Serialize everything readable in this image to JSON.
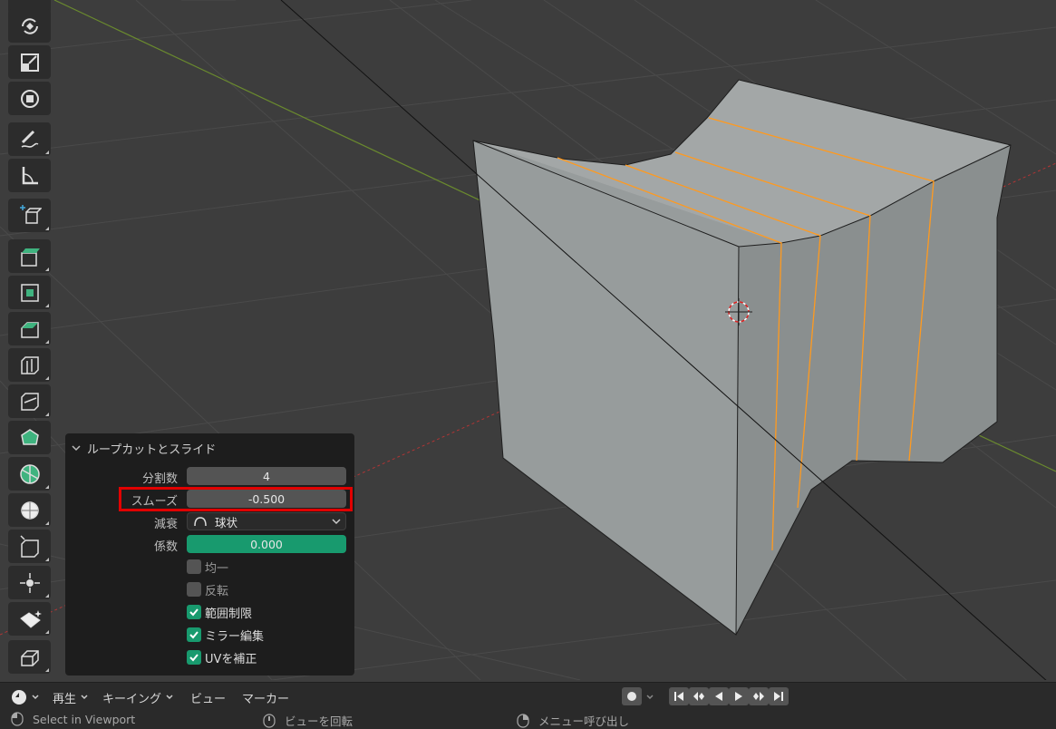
{
  "operator_panel": {
    "title": "ループカットとスライド",
    "fields": {
      "cuts": {
        "label": "分割数",
        "value": "4"
      },
      "smooth": {
        "label": "スムーズ",
        "value": "-0.500"
      },
      "falloff": {
        "label": "減衰",
        "value": "球状",
        "icon": "sphere-falloff-icon"
      },
      "factor": {
        "label": "係数",
        "value": "0.000"
      }
    },
    "checkboxes": {
      "even": {
        "label": "均一",
        "checked": false
      },
      "flip": {
        "label": "反転",
        "checked": false
      },
      "clamp": {
        "label": "範囲制限",
        "checked": true
      },
      "mirror": {
        "label": "ミラー編集",
        "checked": true
      },
      "correct_uv": {
        "label": "UVを補正",
        "checked": true
      }
    }
  },
  "timeline": {
    "playback": "再生",
    "keying": "キーイング",
    "view": "ビュー",
    "marker": "マーカー"
  },
  "status_bar": {
    "left": "Select in Viewport",
    "middle": "ビューを回転",
    "right": "メニュー呼び出し"
  },
  "colors": {
    "accent_green": "#189a6e",
    "highlight_red": "#e10000",
    "edge_orange": "#ff9a1f"
  }
}
